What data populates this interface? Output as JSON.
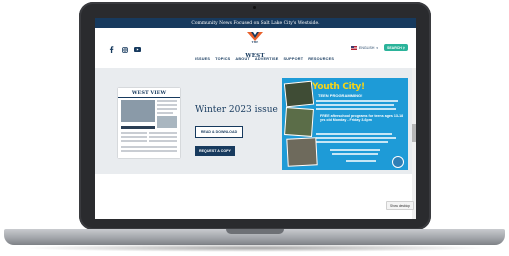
{
  "site": {
    "banner_text": "Community News Focused on Salt Lake City's Westside.",
    "logo_prefix": "THE",
    "logo_name": "WEST VIEW",
    "nav_items": [
      "ISSUES",
      "TOPICS",
      "ABOUT",
      "ADVERTISE",
      "SUPPORT",
      "RESOURCES"
    ],
    "language": "ENGLISH",
    "search_label": "SEARCH",
    "social_icons": [
      "facebook-icon",
      "instagram-icon",
      "youtube-icon"
    ]
  },
  "hero": {
    "issue_title": "Winter 2023 issue",
    "read_button": "READ & DOWNLOAD",
    "request_button": "REQUEST A COPY",
    "newspaper_masthead": "WEST VIEW"
  },
  "ad": {
    "title": "Youth City!",
    "subtitle": "TEEN PROGRAMMING!",
    "free_text": "FREE afterschool programs for teens ages 13-18 yrs old Monday - Friday 3-6pm"
  },
  "footer": {
    "show_desktop_label": "Show desktop"
  },
  "colors": {
    "navy": "#173a5e",
    "accent_teal": "#2bb39a",
    "logo_orange": "#e8612c",
    "ad_blue": "#1e9bd7",
    "ad_yellow": "#f7d417"
  }
}
